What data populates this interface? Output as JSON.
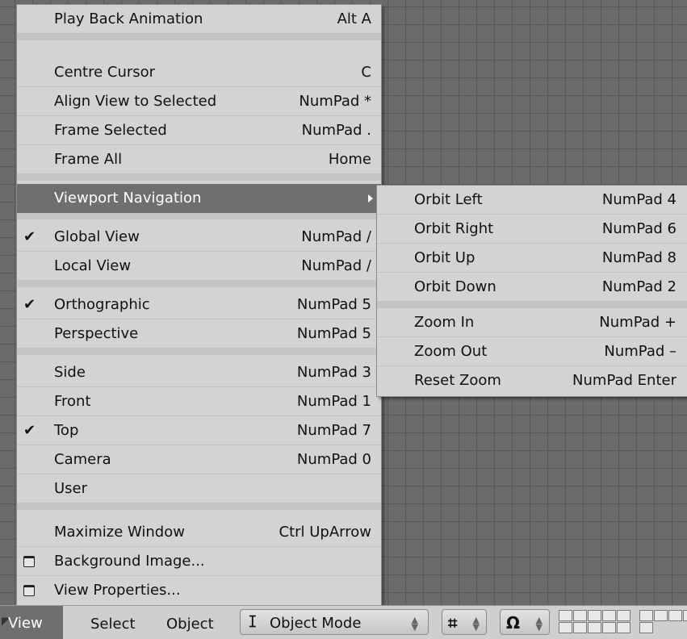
{
  "view_menu": {
    "items": [
      {
        "label": "Play Back Animation",
        "shortcut": "Alt A"
      },
      {
        "label": "Centre Cursor",
        "shortcut": "C"
      },
      {
        "label": "Align View to Selected",
        "shortcut": "NumPad *"
      },
      {
        "label": "Frame Selected",
        "shortcut": "NumPad ."
      },
      {
        "label": "Frame All",
        "shortcut": "Home"
      },
      {
        "label": "Viewport Navigation",
        "shortcut": ""
      },
      {
        "label": "Global View",
        "shortcut": "NumPad /",
        "checked": true
      },
      {
        "label": "Local View",
        "shortcut": "NumPad /"
      },
      {
        "label": "Orthographic",
        "shortcut": "NumPad 5",
        "checked": true
      },
      {
        "label": "Perspective",
        "shortcut": "NumPad 5"
      },
      {
        "label": "Side",
        "shortcut": "NumPad 3"
      },
      {
        "label": "Front",
        "shortcut": "NumPad 1"
      },
      {
        "label": "Top",
        "shortcut": "NumPad 7",
        "checked": true
      },
      {
        "label": "Camera",
        "shortcut": "NumPad 0"
      },
      {
        "label": "User",
        "shortcut": ""
      },
      {
        "label": "Maximize Window",
        "shortcut": "Ctrl UpArrow"
      },
      {
        "label": "Background Image...",
        "shortcut": ""
      },
      {
        "label": "View Properties...",
        "shortcut": ""
      }
    ],
    "check_mark": "✔"
  },
  "viewport_navigation_submenu": {
    "items": [
      {
        "label": "Orbit Left",
        "shortcut": "NumPad 4"
      },
      {
        "label": "Orbit Right",
        "shortcut": "NumPad 6"
      },
      {
        "label": "Orbit Up",
        "shortcut": "NumPad 8"
      },
      {
        "label": "Orbit Down",
        "shortcut": "NumPad 2"
      },
      {
        "label": "Zoom In",
        "shortcut": "NumPad +"
      },
      {
        "label": "Zoom Out",
        "shortcut": "NumPad –"
      },
      {
        "label": "Reset Zoom",
        "shortcut": "NumPad Enter"
      }
    ]
  },
  "header_bar": {
    "menus": {
      "view": "View",
      "select": "Select",
      "object": "Object"
    },
    "mode": {
      "label": "Object Mode",
      "icon": "object-mode-icon"
    },
    "draw_type_icon": "cube-wireframe-icon",
    "pivot_icon": "omega-icon",
    "spinner_glyph": "÷"
  },
  "colors": {
    "menu_bg": "#d3d3d3",
    "highlight_bg": "#6f6f6f",
    "viewport_bg": "#6b6b6b",
    "grid_line": "#585858"
  }
}
